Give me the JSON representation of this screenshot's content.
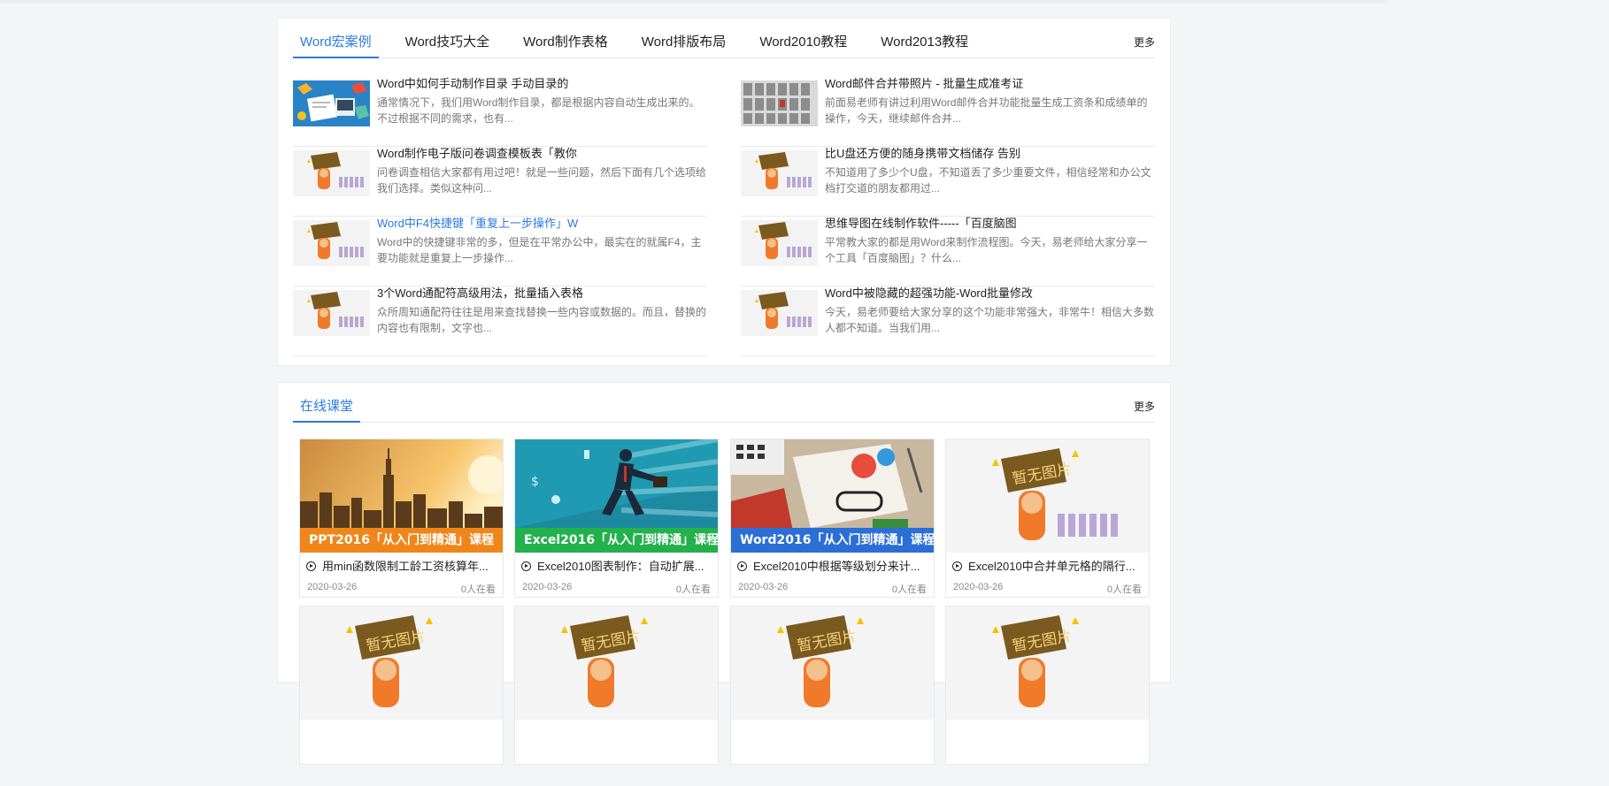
{
  "word_section": {
    "tabs": [
      "Word宏案例",
      "Word技巧大全",
      "Word制作表格",
      "Word排版布局",
      "Word2010教程",
      "Word2013教程"
    ],
    "more": "更多",
    "left_items": [
      {
        "title": "Word中如何手动制作目录 手动目录的",
        "desc": "通常情况下，我们用Word制作目录，都是根据内容自动生成出来的。不过根据不同的需求，也有...",
        "thumb": "workspace-illustration-icon"
      },
      {
        "title": "Word制作电子版问卷调查模板表「教你",
        "desc": "问卷调查相信大家都有用过吧！就是一些问题，然后下面有几个选项给我们选择。类似这种问...",
        "thumb": "no-image-placeholder-icon"
      },
      {
        "title": "Word中F4快捷键「重复上一步操作」W",
        "desc": "Word中的快捷键非常的多，但是在平常办公中，最实在的就属F4，主要功能就是重复上一步操作...",
        "thumb": "no-image-placeholder-icon",
        "highlight": true
      },
      {
        "title": "3个Word通配符高级用法，批量插入表格",
        "desc": "众所周知通配符往往是用来查找替换一些内容或数据的。而且，替换的内容也有限制，文字也...",
        "thumb": "no-image-placeholder-icon"
      }
    ],
    "right_items": [
      {
        "title": "Word邮件合并带照片 - 批量生成准考证",
        "desc": "前面易老师有讲过利用Word邮件合并功能批量生成工资条和成绩单的操作，今天，继续邮件合并...",
        "thumb": "photo-grid-icon"
      },
      {
        "title": "比U盘还方便的随身携带文档储存 告别",
        "desc": "不知道用了多少个U盘，不知道丢了多少重要文件，相信经常和办公文档打交道的朋友都用过...",
        "thumb": "no-image-placeholder-icon"
      },
      {
        "title": "思维导图在线制作软件-----「百度脑图",
        "desc": "平常教大家的都是用Word来制作流程图。今天，易老师给大家分享一个工具「百度脑图」？什么...",
        "thumb": "no-image-placeholder-icon"
      },
      {
        "title": "Word中被隐藏的超强功能-Word批量修改",
        "desc": "今天，易老师要给大家分享的这个功能非常强大，非常牛！相信大多数人都不知道。当我们用...",
        "thumb": "no-image-placeholder-icon"
      }
    ]
  },
  "course_section": {
    "tab": "在线课堂",
    "more": "更多",
    "cards": [
      {
        "band": "PPT2016「从入门到精通」课程",
        "band_color": "#f0861a",
        "image": "city-skyline-icon",
        "title": "用min函数限制工龄工资核算年...",
        "date": "2020-03-26",
        "views": "0人在看"
      },
      {
        "band": "Excel2016「从入门到精通」课程",
        "band_color": "#22b14c",
        "image": "running-businessman-icon",
        "title": "Excel2010图表制作：自动扩展...",
        "date": "2020-03-26",
        "views": "0人在看"
      },
      {
        "band": "Word2016「从入门到精通」课程",
        "band_color": "#2b6fd6",
        "image": "office-desk-icon",
        "title": "Excel2010中根据等级划分来计...",
        "date": "2020-03-26",
        "views": "0人在看"
      },
      {
        "band": "",
        "band_color": "",
        "image": "no-image-placeholder-icon",
        "title": "Excel2010中合并单元格的隔行...",
        "date": "2020-03-26",
        "views": "0人在看"
      },
      {
        "band": "",
        "image": "no-image-placeholder-icon"
      },
      {
        "band": "",
        "image": "no-image-placeholder-icon"
      },
      {
        "band": "",
        "image": "no-image-placeholder-icon"
      },
      {
        "band": "",
        "image": "no-image-placeholder-icon"
      }
    ]
  },
  "colors": {
    "accent": "#2b7be0",
    "orange": "#f0861a",
    "green": "#22b14c",
    "blue": "#2b6fd6"
  },
  "placeholder_text": "暂无图片"
}
